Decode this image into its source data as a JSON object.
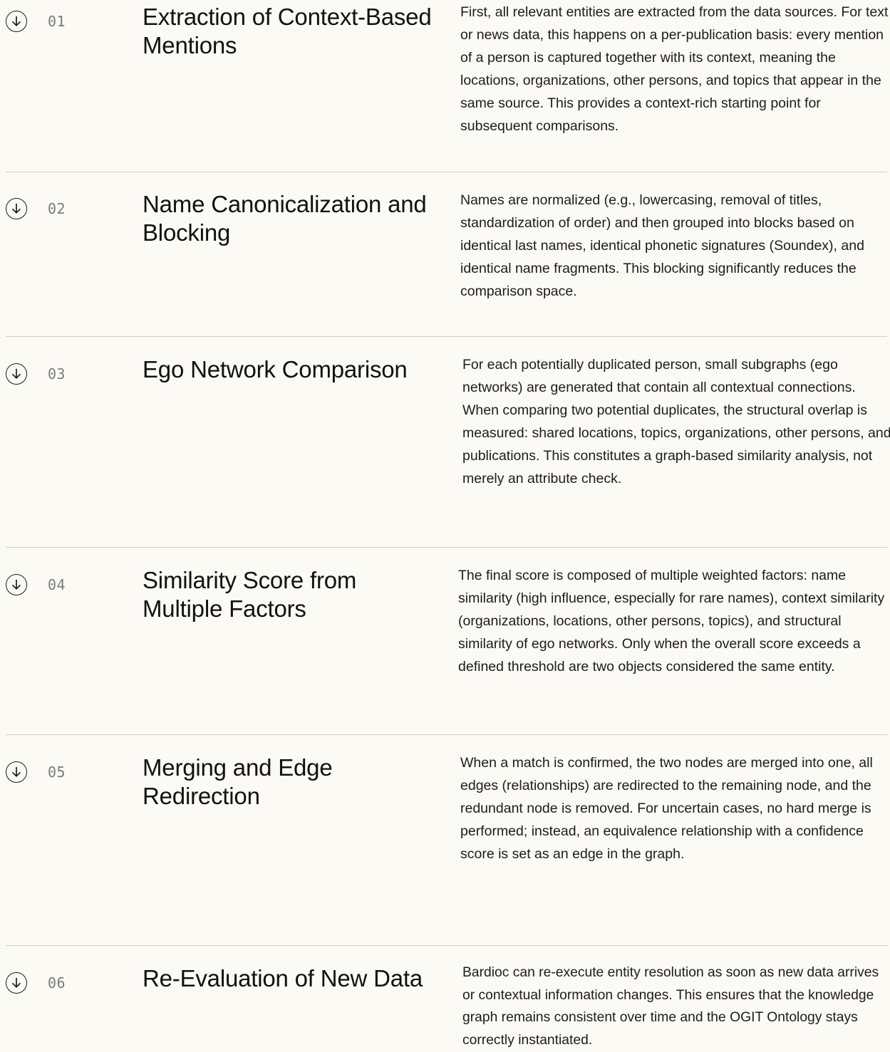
{
  "steps": [
    {
      "number": "01",
      "icon": "arrow-down-circle-icon",
      "title": "Extraction of Context-Based Mentions",
      "description": "First, all relevant entities are extracted from the data sources. For text or news data, this happens on a per-publication basis: every mention of a person is captured together with its context, meaning the locations, organizations, other persons, and topics that appear in the same source. This provides a context-rich starting point for subsequent comparisons."
    },
    {
      "number": "02",
      "icon": "arrow-down-circle-icon",
      "title": "Name Canonicalization and Blocking",
      "description": "Names are normalized (e.g., lowercasing, removal of titles, standardization of order) and then grouped into blocks based on identical last names, identical phonetic signatures (Soundex), and identical name fragments. This blocking significantly reduces the comparison space."
    },
    {
      "number": "03",
      "icon": "arrow-down-circle-icon",
      "title": "Ego Network Comparison",
      "description": "For each potentially duplicated person, small subgraphs (ego networks) are generated that contain all contextual connections. When comparing two potential duplicates, the structural overlap is measured: shared locations, topics, organizations, other persons, and publications. This constitutes a graph-based similarity analysis, not merely an attribute check."
    },
    {
      "number": "04",
      "icon": "arrow-down-circle-icon",
      "title": "Similarity Score from Multiple Factors",
      "description": "The final score is composed of multiple weighted factors: name similarity (high influence, especially for rare names), context similarity (organizations, locations, other persons, topics), and structural similarity of ego networks. Only when the overall score exceeds a defined threshold are two objects considered the same entity."
    },
    {
      "number": "05",
      "icon": "arrow-down-circle-icon",
      "title": "Merging and Edge Redirection",
      "description": "When a match is confirmed, the two nodes are merged into one, all edges (relationships) are redirected to the remaining node, and the redundant node is removed. For uncertain cases, no hard merge is performed; instead, an equivalence relationship with a confidence score is set as an edge in the graph."
    },
    {
      "number": "06",
      "icon": "arrow-down-circle-icon",
      "title": "Re-Evaluation of New Data",
      "description": "Bardioc can re-execute entity resolution as soon as new data arrives or contextual information changes. This ensures that the knowledge graph remains consistent over time and the OGIT Ontology stays correctly instantiated."
    }
  ]
}
